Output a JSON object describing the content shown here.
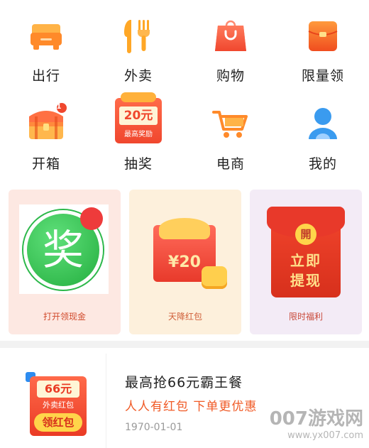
{
  "grid": [
    {
      "label": "出行",
      "icon": "car-icon"
    },
    {
      "label": "外卖",
      "icon": "fork-knife-icon"
    },
    {
      "label": "购物",
      "icon": "shopping-bag-icon"
    },
    {
      "label": "限量领",
      "icon": "red-envelope-icon"
    },
    {
      "label": "开箱",
      "icon": "treasure-chest-icon",
      "badge": "1"
    },
    {
      "label": "抽奖",
      "icon": "lottery-icon",
      "prize_amount": "20元",
      "prize_caption": "最高奖励"
    },
    {
      "label": "电商",
      "icon": "shopping-cart-icon"
    },
    {
      "label": "我的",
      "icon": "user-icon"
    }
  ],
  "cards": [
    {
      "label": "打开领现金",
      "glyph": "奖"
    },
    {
      "label": "天降红包",
      "amount": "¥20"
    },
    {
      "label": "限时福利",
      "seal": "開",
      "line1": "立即",
      "line2": "提现"
    }
  ],
  "promo": {
    "title": "最高抢66元霸王餐",
    "subtitle": "人人有红包 下单更优惠",
    "date": "1970-01-01",
    "thumb_amount": "66元",
    "thumb_caption": "外卖红包",
    "thumb_button": "领红包"
  },
  "watermark": {
    "line1": "007游戏网",
    "line2": "www.yx007.com"
  },
  "colors": {
    "orange": "#ff8a2a",
    "red": "#f0472e",
    "blue": "#3a9bef",
    "subtitle": "#f05a26"
  }
}
